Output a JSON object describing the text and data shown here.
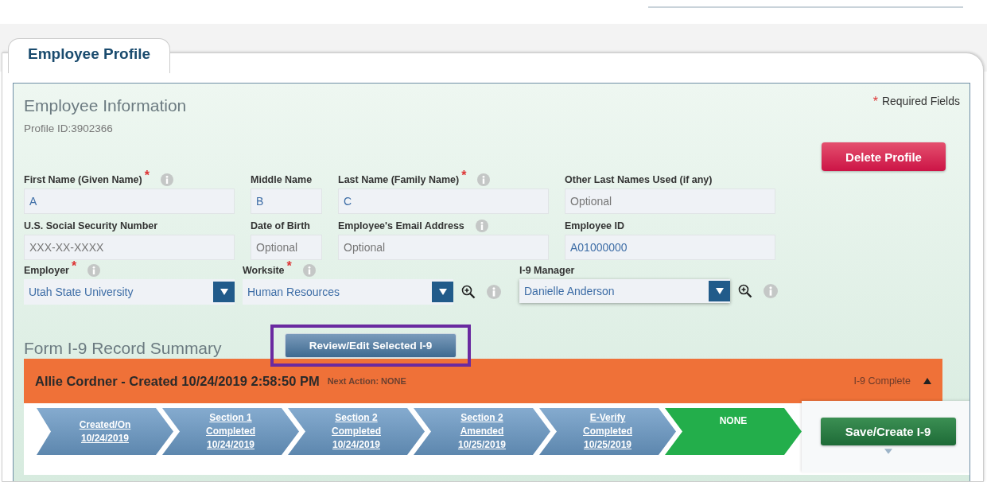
{
  "tabs": [
    {
      "label": "Employee Profile",
      "selected": true
    }
  ],
  "section": {
    "title": "Employee Information",
    "profile_id": "Profile ID:3902366",
    "required_note": {
      "mark": "*",
      "text": "Required Fields"
    },
    "delete_button": "Delete Profile"
  },
  "field_rows": [
    [
      {
        "label": "First Name (Given Name)",
        "required_mark": "*",
        "info": true,
        "kind": "text",
        "value": "A"
      },
      {
        "label": "Middle Name",
        "info": false,
        "kind": "text",
        "value": "B"
      },
      {
        "label": "Last Name (Family Name)",
        "required_mark": "*",
        "info": true,
        "kind": "text",
        "value": "C"
      },
      {
        "label": "Other Last Names Used (if any)",
        "info": false,
        "kind": "text",
        "placeholder": "Optional"
      }
    ],
    [
      {
        "label": "U.S. Social Security Number",
        "info": false,
        "kind": "text",
        "placeholder": "XXX-XX-XXXX"
      },
      {
        "label": "Date of Birth",
        "info": false,
        "kind": "text",
        "placeholder": "Optional"
      },
      {
        "label": "Employee's Email Address",
        "info": true,
        "kind": "text",
        "placeholder": "Optional"
      },
      {
        "label": "Employee ID",
        "info": false,
        "kind": "text",
        "value": "A01000000"
      }
    ]
  ],
  "selects": [
    {
      "label": "Employer",
      "required_mark": "*",
      "label_info": true,
      "value": "Utah State University",
      "lookup": false,
      "info": false
    },
    {
      "label": "Worksite",
      "required_mark": "*",
      "label_info": true,
      "value": "Human Resources",
      "lookup": true,
      "info": true
    },
    {
      "label": "I-9 Manager",
      "label_info": false,
      "value": "Danielle Anderson",
      "lookup": true,
      "info": true
    }
  ],
  "summary": {
    "title": "Form I-9 Record Summary",
    "review_button": "Review/Edit Selected I-9",
    "highlighted": true
  },
  "record": {
    "title": "Allie Cordner - Created 10/24/2019 2:58:50 PM",
    "next_action": "Next Action: NONE",
    "status": "I-9 Complete",
    "expanded": true,
    "steps": [
      {
        "lines": [
          "Created/On",
          "10/24/2019"
        ],
        "current": false
      },
      {
        "lines": [
          "Section 1",
          "Completed",
          "10/24/2019"
        ],
        "current": false
      },
      {
        "lines": [
          "Section 2",
          "Completed",
          "10/24/2019"
        ],
        "current": false
      },
      {
        "lines": [
          "Section 2",
          "Amended",
          "10/25/2019"
        ],
        "current": false
      },
      {
        "lines": [
          "E-Verify",
          "Completed",
          "10/25/2019"
        ],
        "current": false
      },
      {
        "lines": [
          "NONE"
        ],
        "current": true
      }
    ]
  },
  "save_button": "Save/Create I-9"
}
